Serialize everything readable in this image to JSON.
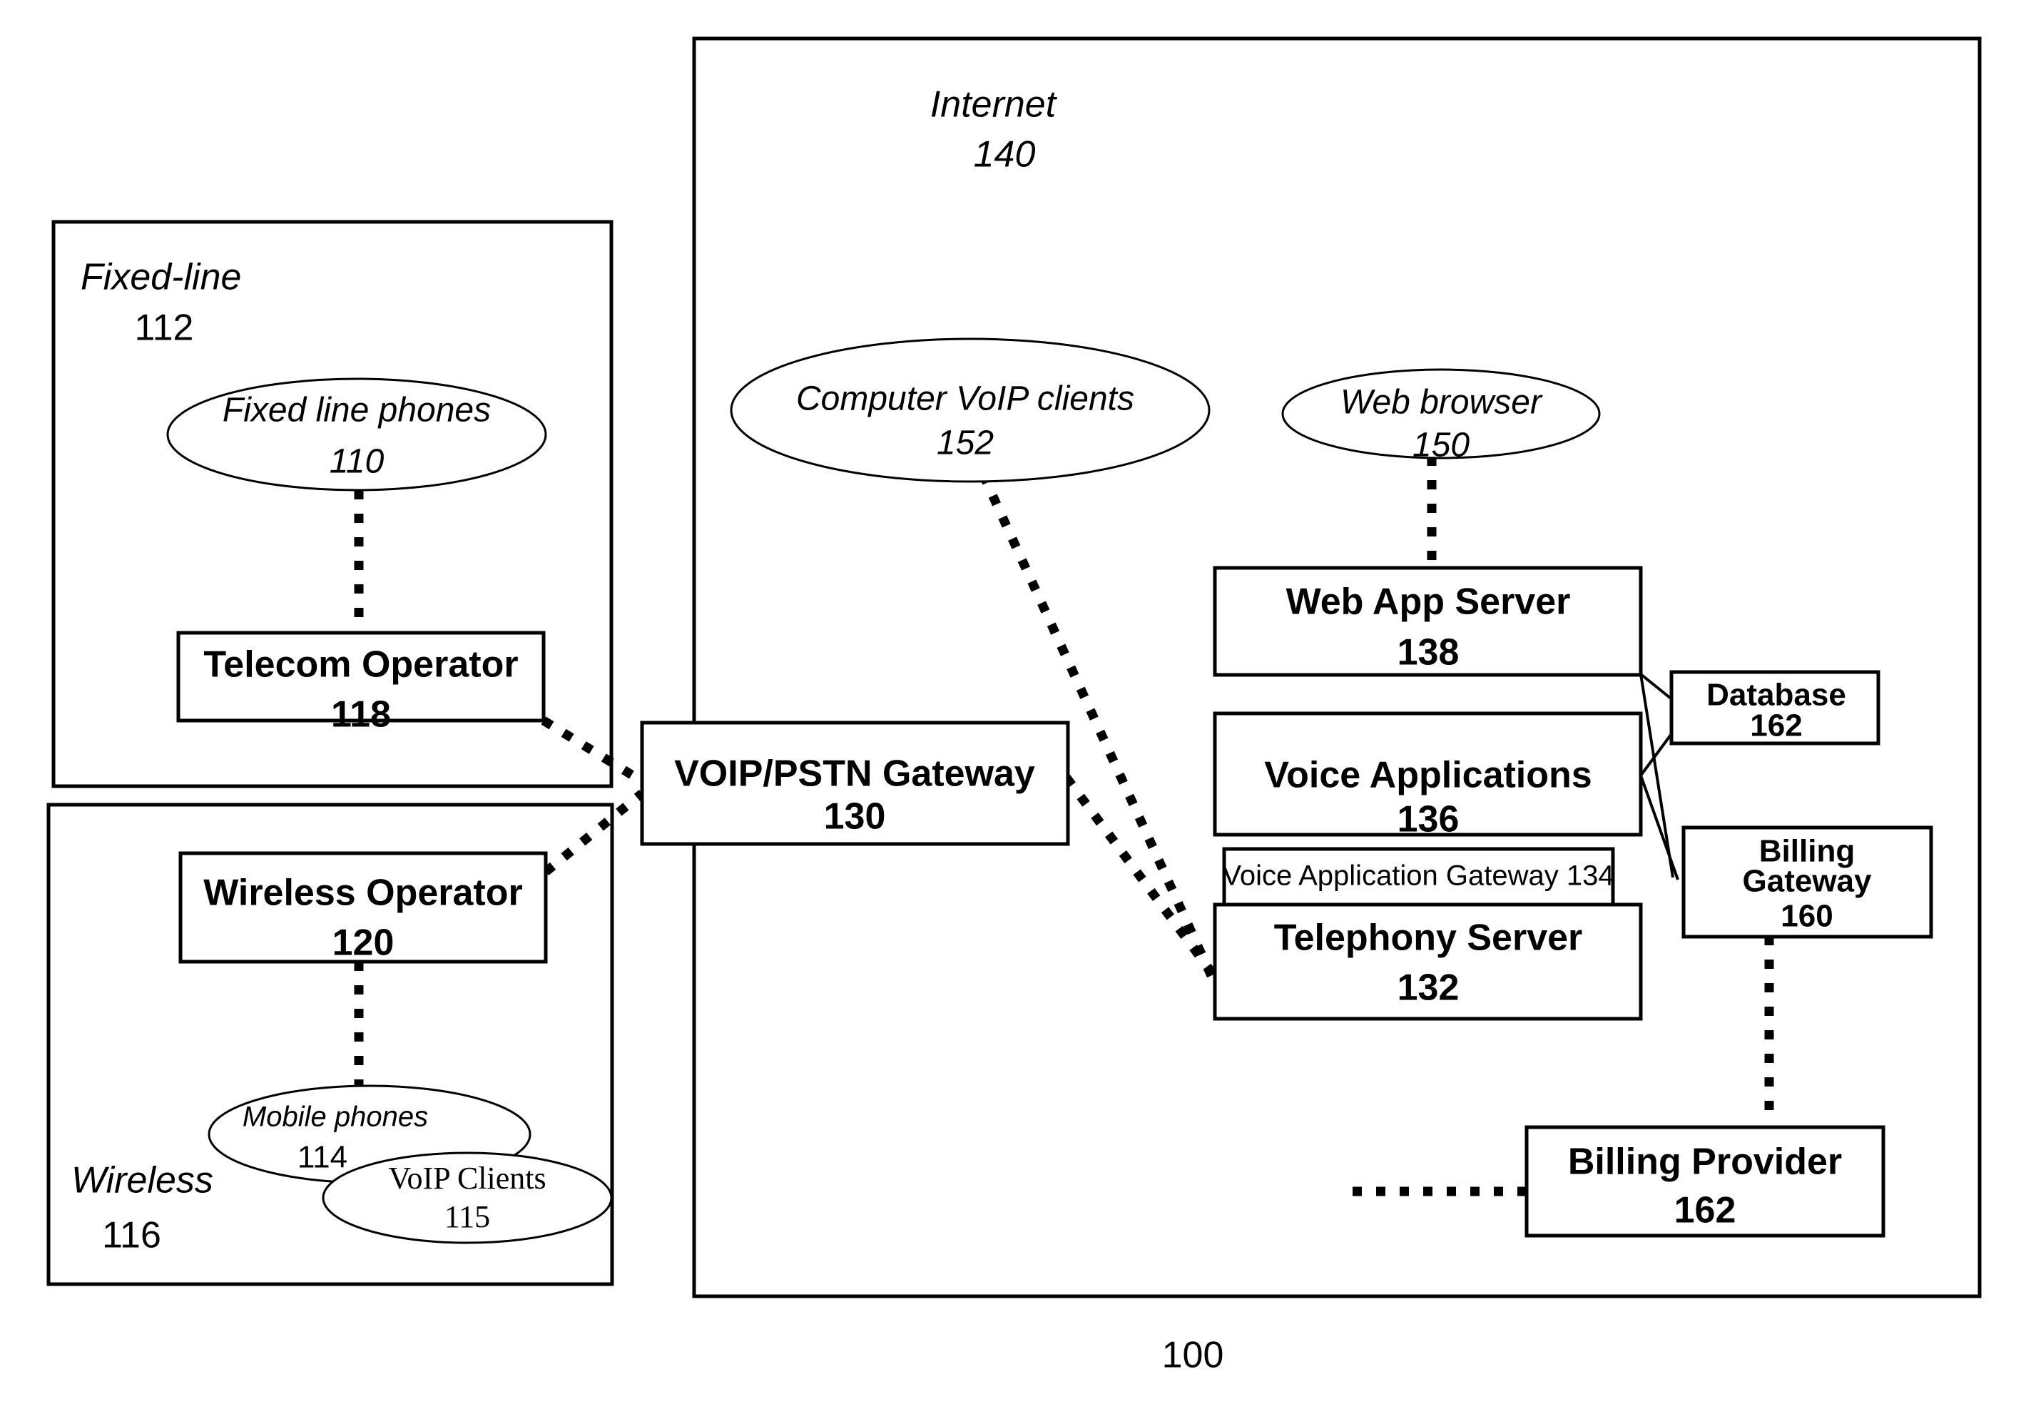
{
  "figure": {
    "caption": "100"
  },
  "containers": [
    {
      "id": "fixed-line",
      "label": "Fixed-line",
      "ref": "112"
    },
    {
      "id": "wireless",
      "label": "Wireless",
      "ref": "116"
    },
    {
      "id": "internet",
      "label": "Internet",
      "ref": "140"
    }
  ],
  "nodes": {
    "fixed_line_phones": {
      "label": "Fixed line phones",
      "ref": "110"
    },
    "telecom_operator": {
      "label": "Telecom Operator",
      "ref": "118"
    },
    "wireless_operator": {
      "label": "Wireless Operator",
      "ref": "120"
    },
    "mobile_phones": {
      "label": "Mobile phones",
      "ref": "114"
    },
    "voip_clients": {
      "label": "VoIP Clients",
      "ref": "115"
    },
    "voip_pstn_gateway": {
      "label": "VOIP/PSTN Gateway",
      "ref": "130"
    },
    "computer_voip_clients": {
      "label": "Computer VoIP clients",
      "ref": "152"
    },
    "web_browser": {
      "label": "Web browser",
      "ref": "150"
    },
    "web_app_server": {
      "label": "Web App Server",
      "ref": "138"
    },
    "voice_applications": {
      "label": "Voice Applications",
      "ref": "136"
    },
    "voice_application_gateway": {
      "label": "Voice Application Gateway 134"
    },
    "telephony_server": {
      "label": "Telephony Server",
      "ref": "132"
    },
    "database": {
      "label": "Database",
      "ref": "162"
    },
    "billing_gateway_line1": {
      "label": "Billing"
    },
    "billing_gateway_line2": {
      "label": "Gateway",
      "ref": "160"
    },
    "billing_provider": {
      "label": "Billing Provider",
      "ref": "162"
    }
  },
  "colors": {
    "stroke": "#000000",
    "fill": "#ffffff"
  }
}
